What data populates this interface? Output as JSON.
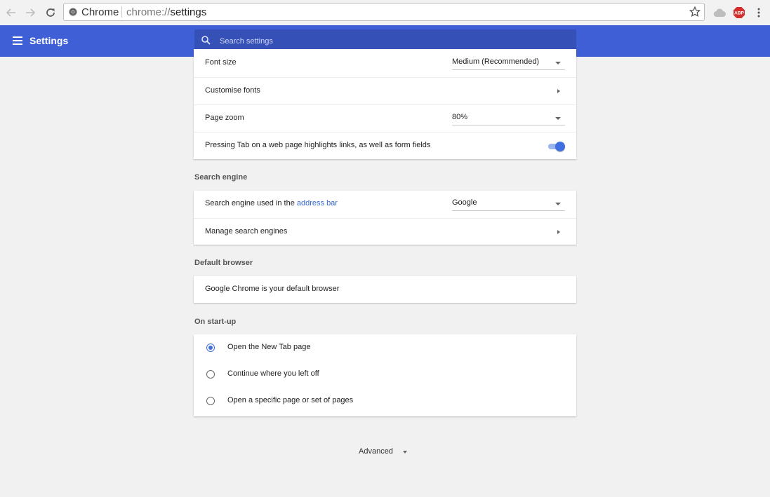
{
  "browser": {
    "site_name": "Chrome",
    "url_prefix": "chrome://",
    "url_path": "settings",
    "abp_label": "ABP"
  },
  "header": {
    "title": "Settings",
    "search_placeholder": "Search settings"
  },
  "appearance": {
    "font_size_label": "Font size",
    "font_size_value": "Medium (Recommended)",
    "customise_fonts_label": "Customise fonts",
    "page_zoom_label": "Page zoom",
    "page_zoom_value": "80%",
    "tab_highlight_label": "Pressing Tab on a web page highlights links, as well as form fields",
    "tab_highlight_enabled": true
  },
  "search_engine": {
    "section_title": "Search engine",
    "used_label_prefix": "Search engine used in the ",
    "used_label_link": "address bar",
    "engine_value": "Google",
    "manage_label": "Manage search engines"
  },
  "default_browser": {
    "section_title": "Default browser",
    "status": "Google Chrome is your default browser"
  },
  "startup": {
    "section_title": "On start-up",
    "options": [
      {
        "label": "Open the New Tab page",
        "checked": true
      },
      {
        "label": "Continue where you left off",
        "checked": false
      },
      {
        "label": "Open a specific page or set of pages",
        "checked": false
      }
    ]
  },
  "advanced_label": "Advanced",
  "colors": {
    "header_blue": "#3f5fd6",
    "accent_blue": "#3f6fe0",
    "link_blue": "#3367d6"
  }
}
